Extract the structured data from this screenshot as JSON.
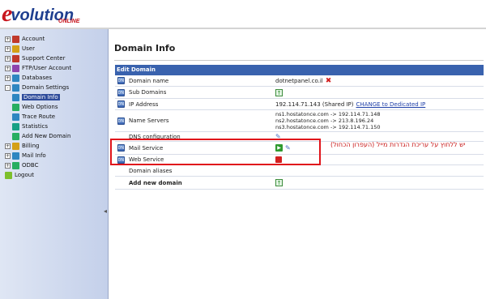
{
  "brand": {
    "e": "e",
    "rest": "volution",
    "online": "ONLINE"
  },
  "sidebar": {
    "items": [
      {
        "label": "Account",
        "expander": "+",
        "icon": "account-icon",
        "color": "#c0392b"
      },
      {
        "label": "User",
        "expander": "+",
        "icon": "user-icon",
        "color": "#d4a017"
      },
      {
        "label": "Support Center",
        "expander": "+",
        "icon": "support-icon",
        "color": "#c0392b"
      },
      {
        "label": "FTP/User Account",
        "expander": "+",
        "icon": "ftp-icon",
        "color": "#8e44ad"
      },
      {
        "label": "Databases",
        "expander": "+",
        "icon": "database-icon",
        "color": "#2e86c1"
      },
      {
        "label": "Domain Settings",
        "expander": "-",
        "icon": "domain-settings-icon",
        "color": "#2e86c1"
      }
    ],
    "subitems": [
      {
        "label": "Domain Info",
        "icon": "domain-info-icon",
        "color": "#2e86c1",
        "selected": true
      },
      {
        "label": "Web Options",
        "icon": "web-options-icon",
        "color": "#27ae60"
      },
      {
        "label": "Trace Route",
        "icon": "trace-route-icon",
        "color": "#2e86c1"
      },
      {
        "label": "Statistics",
        "icon": "statistics-icon",
        "color": "#16a085"
      },
      {
        "label": "Add New Domain",
        "icon": "add-domain-icon",
        "color": "#27ae60"
      }
    ],
    "items2": [
      {
        "label": "Billing",
        "expander": "+",
        "icon": "billing-icon",
        "color": "#d4a017"
      },
      {
        "label": "Mail Info",
        "expander": "+",
        "icon": "mail-icon",
        "color": "#2e86c1"
      },
      {
        "label": "ODBC",
        "expander": "+",
        "icon": "odbc-icon",
        "color": "#27ae60"
      },
      {
        "label": "Logout",
        "expander": "",
        "icon": "logout-icon",
        "color": "#7dbf2c"
      }
    ],
    "collapse_handle": "◂"
  },
  "main": {
    "title": "Domain Info",
    "table_header": "Edit Domain",
    "rows": [
      {
        "label": "Domain name",
        "value": "dotnetpanel.co.il"
      },
      {
        "label": "Sub Domains"
      },
      {
        "label": "IP Address",
        "value": "192.114.71.143 (Shared IP)",
        "link": "CHANGE to Dedicated IP"
      },
      {
        "label": "Name Servers",
        "ns": [
          "ns1.hostatonce.com -> 192.114.71.148",
          "ns2.hostatonce.com -> 213.8.196.24",
          "ns3.hostatonce.com -> 192.114.71.150"
        ]
      },
      {
        "label": "DNS configuration"
      },
      {
        "label": "Mail Service"
      },
      {
        "label": "Web Service"
      },
      {
        "label": "Domain aliases"
      },
      {
        "label": "Add new domain"
      }
    ],
    "row_icon_text": "DN"
  },
  "annotation": {
    "note": "יש ללחוץ על עריכת הגדרות מייל (העפרון הכחול)",
    "color": "#e0141b"
  }
}
